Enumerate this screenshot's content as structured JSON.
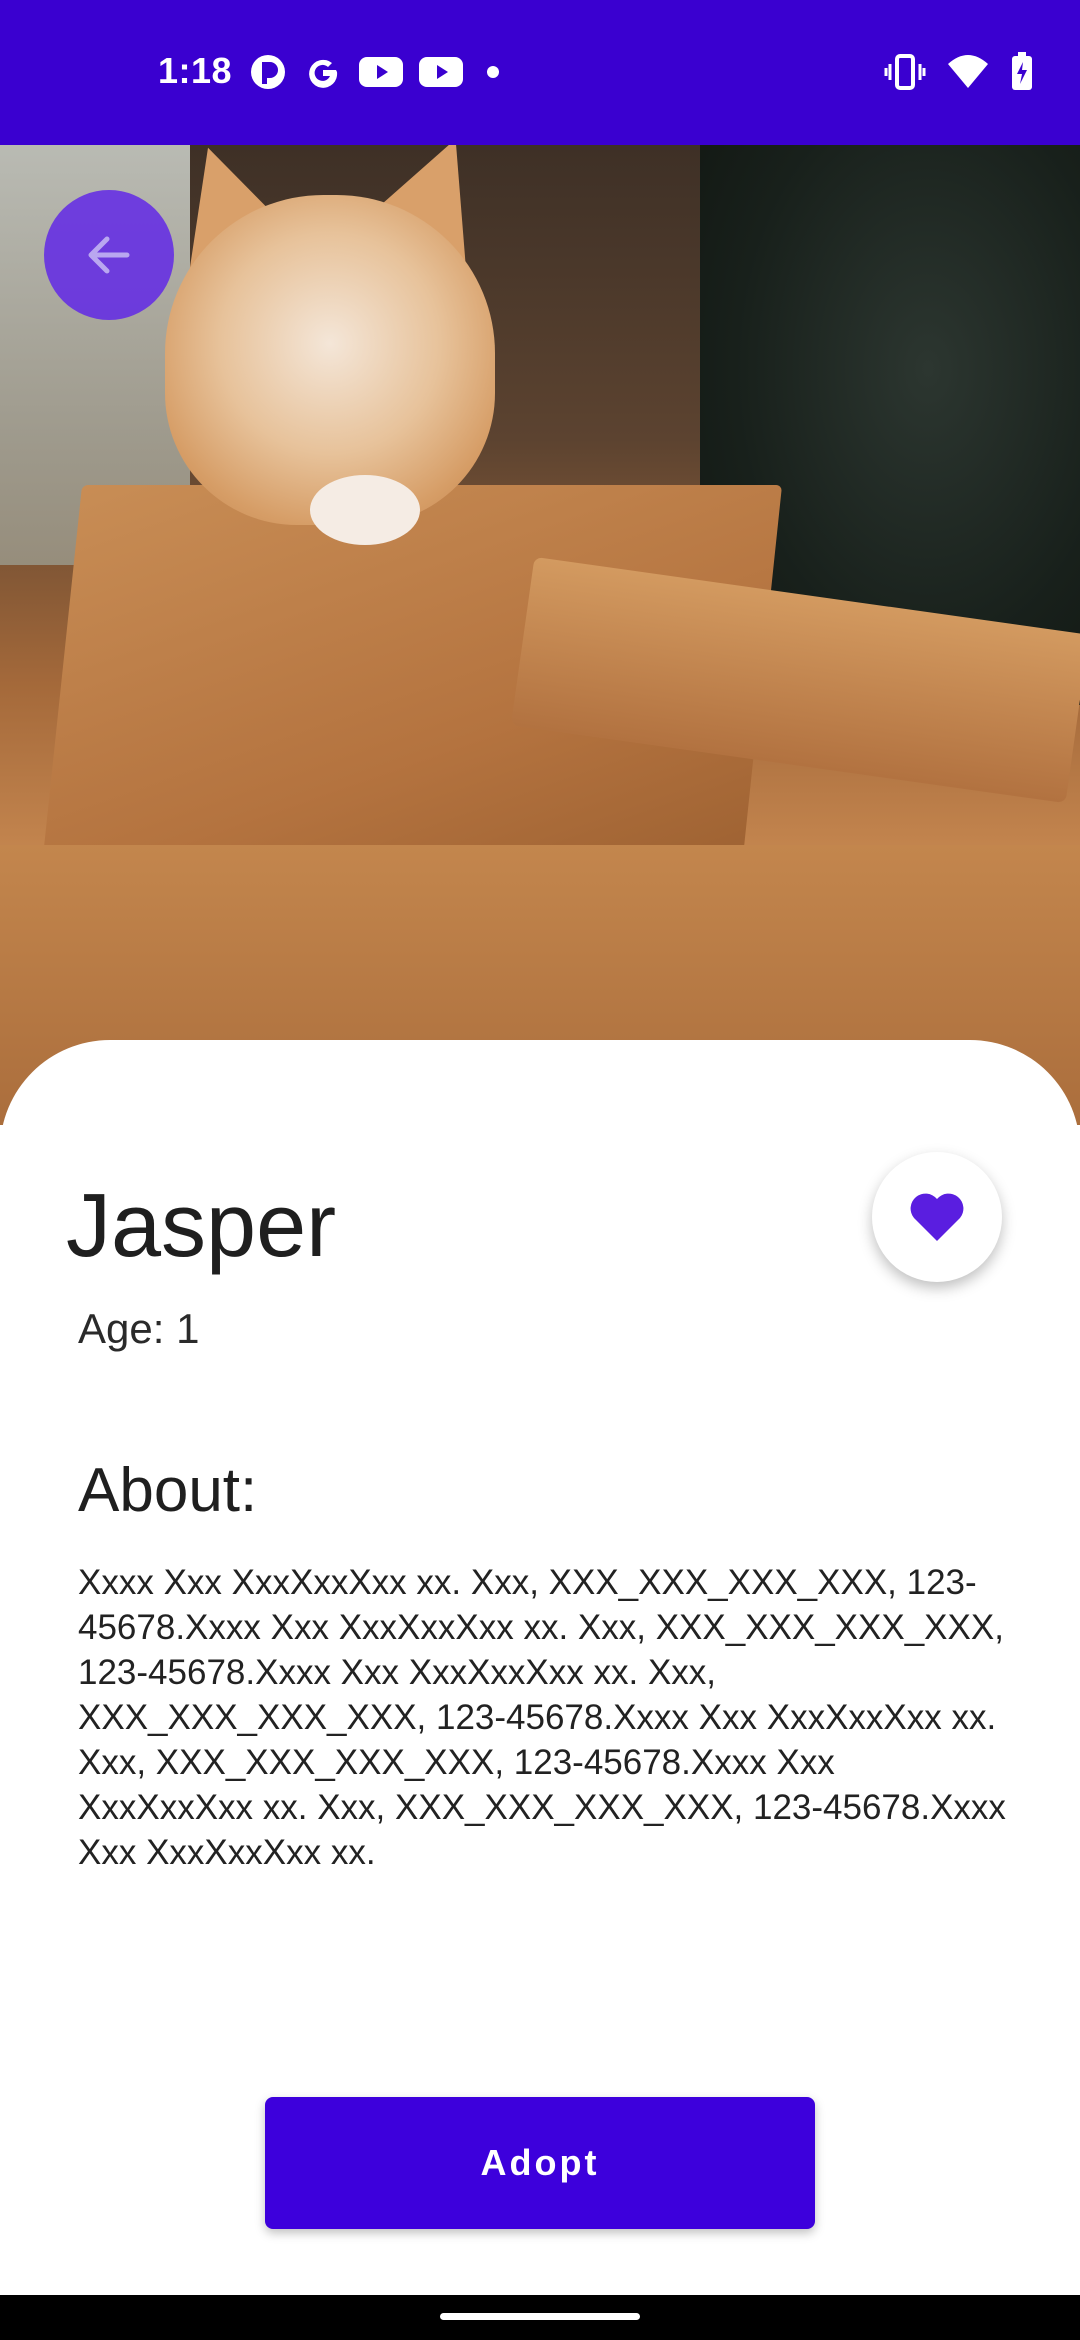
{
  "status_bar": {
    "time": "1:18",
    "left_icons": [
      "notification-app-icon",
      "google-icon",
      "youtube-icon",
      "youtube-icon",
      "dot-icon"
    ],
    "right_icons": [
      "vibrate-icon",
      "wifi-icon",
      "battery-charging-icon"
    ],
    "background": "#3a00d0"
  },
  "hero": {
    "image_subject": "kitten in cardboard tank"
  },
  "pet": {
    "name": "Jasper",
    "age": "Age: 1"
  },
  "about": {
    "title": "About:",
    "body": "Xxxx Xxx XxxXxxXxx xx. Xxx, XXX_XXX_XXX_XXX, 123-45678.Xxxx Xxx XxxXxxXxx xx. Xxx, XXX_XXX_XXX_XXX, 123-45678.Xxxx Xxx XxxXxxXxx xx. Xxx, XXX_XXX_XXX_XXX, 123-45678.Xxxx Xxx XxxXxxXxx xx. Xxx, XXX_XXX_XXX_XXX, 123-45678.Xxxx Xxx XxxXxxXxx xx. Xxx, XXX_XXX_XXX_XXX, 123-45678.Xxxx Xxx XxxXxxXxx xx."
  },
  "actions": {
    "adopt_label": "Adopt",
    "favorite_icon": "heart-icon",
    "back_icon": "arrow-back-icon"
  },
  "colors": {
    "accent": "#3d00dc",
    "heart": "#5a1ee0"
  }
}
